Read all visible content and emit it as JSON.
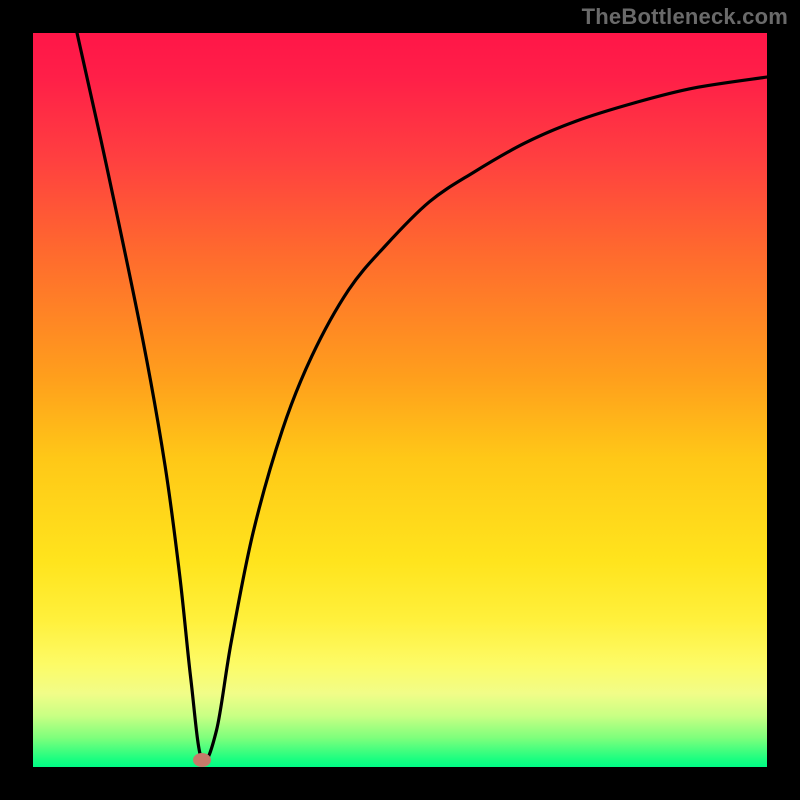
{
  "watermark": "TheBottleneck.com",
  "colors": {
    "frame": "#000000",
    "curve": "#000000",
    "marker": "#c77a6a",
    "gradient_top": "#ff1648",
    "gradient_bottom": "#00fc85"
  },
  "chart_data": {
    "type": "line",
    "title": "",
    "xlabel": "",
    "ylabel": "",
    "xlim": [
      0,
      100
    ],
    "ylim": [
      0,
      100
    ],
    "grid": false,
    "annotations": [
      {
        "label": "minimum-marker",
        "x": 23,
        "y": 1
      }
    ],
    "series": [
      {
        "name": "bottleneck-curve",
        "x": [
          6,
          10,
          15,
          18,
          20,
          21.5,
          23,
          25,
          27,
          30,
          34,
          38,
          43,
          48,
          54,
          60,
          67,
          74,
          82,
          90,
          100
        ],
        "y": [
          100,
          82,
          58,
          41,
          26,
          12,
          1,
          5,
          17,
          32,
          46,
          56,
          65,
          71,
          77,
          81,
          85,
          88,
          90.5,
          92.5,
          94
        ]
      }
    ]
  }
}
